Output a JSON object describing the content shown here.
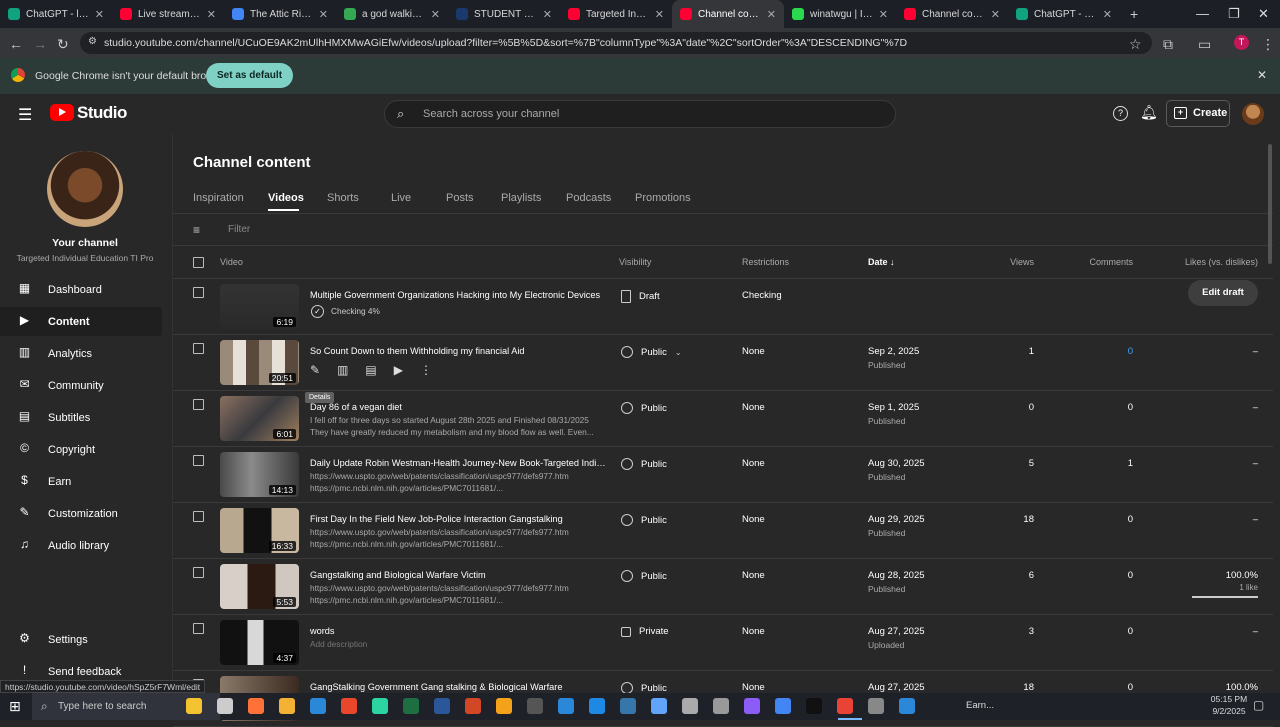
{
  "browser": {
    "tabs": [
      {
        "label": "ChatGPT - langua",
        "color": "#10a37f"
      },
      {
        "label": "Live streaming",
        "color": "#ff0033"
      },
      {
        "label": "The Attic Rite: Vo",
        "color": "#4285f4"
      },
      {
        "label": "a god walking the",
        "color": "#34a853"
      },
      {
        "label": "STUDENT SUPPOR",
        "color": "#1a3a6e"
      },
      {
        "label": "Targeted Individu",
        "color": "#ff0033"
      },
      {
        "label": "Channel content -",
        "color": "#ff0033"
      },
      {
        "label": "winatwgu | Instag",
        "color": "#2bd94f"
      },
      {
        "label": "Channel content -",
        "color": "#ff0033"
      },
      {
        "label": "ChatGPT - The Att",
        "color": "#10a37f"
      }
    ],
    "url": "studio.youtube.com/channel/UCuOE9AK2mUlhHMXMwAGiEfw/videos/upload?filter=%5B%5D&sort=%7B\"columnType\"%3A\"date\"%2C\"sortOrder\"%3A\"DESCENDING\"%7D",
    "infobar_text": "Google Chrome isn't your default browser",
    "set_default_label": "Set as default",
    "status_url": "https://studio.youtube.com/video/hSpZ5rF7Wml/edit"
  },
  "studio": {
    "logo_text": "Studio",
    "search_placeholder": "Search across your channel",
    "create_label": "Create",
    "avatar_letter": "T"
  },
  "sidebar": {
    "channel_label": "Your channel",
    "channel_name": "Targeted Individual Education TI Pro",
    "items": [
      {
        "label": "Dashboard",
        "icon": "dashboard-icon"
      },
      {
        "label": "Content",
        "icon": "content-icon"
      },
      {
        "label": "Analytics",
        "icon": "analytics-icon"
      },
      {
        "label": "Community",
        "icon": "community-icon"
      },
      {
        "label": "Subtitles",
        "icon": "subtitles-icon"
      },
      {
        "label": "Copyright",
        "icon": "copyright-icon"
      },
      {
        "label": "Earn",
        "icon": "earn-icon"
      },
      {
        "label": "Customization",
        "icon": "customization-icon"
      },
      {
        "label": "Audio library",
        "icon": "audio-library-icon"
      }
    ],
    "settings_label": "Settings",
    "feedback_label": "Send feedback"
  },
  "main": {
    "page_title": "Channel content",
    "tabs": [
      "Inspiration",
      "Videos",
      "Shorts",
      "Live",
      "Posts",
      "Playlists",
      "Podcasts",
      "Promotions"
    ],
    "active_tab": "Videos",
    "filter_placeholder": "Filter",
    "columns": {
      "video": "Video",
      "visibility": "Visibility",
      "restrictions": "Restrictions",
      "date": "Date",
      "views": "Views",
      "comments": "Comments",
      "likes": "Likes (vs. dislikes)"
    },
    "tooltip": "Details",
    "edit_draft_label": "Edit draft",
    "rows": [
      {
        "title": "Multiple Government Organizations Hacking into My Electronic Devices",
        "desc1": "Checking 4%",
        "desc2": "",
        "duration": "6:19",
        "visibility": "Draft",
        "restrictions": "Checking",
        "date": "",
        "status": "",
        "views": "",
        "comments": "",
        "likes": "",
        "likes_sub": ""
      },
      {
        "title": "So Count Down to them Withholding my financial Aid",
        "desc1": "",
        "desc2": "",
        "duration": "20:51",
        "visibility": "Public",
        "restrictions": "None",
        "date": "Sep 2, 2025",
        "status": "Published",
        "views": "1",
        "comments": "0",
        "likes": "–",
        "likes_sub": ""
      },
      {
        "title": "Day 86 of a vegan diet",
        "desc1": "I fell off for three days so started August 28th 2025 and Finished 08/31/2025",
        "desc2": "They have greatly reduced my metabolism and my blood flow as well. Even...",
        "duration": "6:01",
        "visibility": "Public",
        "restrictions": "None",
        "date": "Sep 1, 2025",
        "status": "Published",
        "views": "0",
        "comments": "0",
        "likes": "–",
        "likes_sub": ""
      },
      {
        "title": "Daily Update Robin Westman-Health Journey-New Book-Targeted Indivi...",
        "desc1": "https://www.uspto.gov/web/patents/classification/uspc977/defs977.htm",
        "desc2": "https://pmc.ncbi.nlm.nih.gov/articles/PMC7011681/...",
        "duration": "14:13",
        "visibility": "Public",
        "restrictions": "None",
        "date": "Aug 30, 2025",
        "status": "Published",
        "views": "5",
        "comments": "1",
        "likes": "–",
        "likes_sub": ""
      },
      {
        "title": "First Day In the Field New Job-Police Interaction Gangstalking",
        "desc1": "https://www.uspto.gov/web/patents/classification/uspc977/defs977.htm",
        "desc2": "https://pmc.ncbi.nlm.nih.gov/articles/PMC7011681/...",
        "duration": "16:33",
        "visibility": "Public",
        "restrictions": "None",
        "date": "Aug 29, 2025",
        "status": "Published",
        "views": "18",
        "comments": "0",
        "likes": "–",
        "likes_sub": ""
      },
      {
        "title": "Gangstalking and Biological Warfare Victim",
        "desc1": "https://www.uspto.gov/web/patents/classification/uspc977/defs977.htm",
        "desc2": "https://pmc.ncbi.nlm.nih.gov/articles/PMC7011681/...",
        "duration": "5:53",
        "visibility": "Public",
        "restrictions": "None",
        "date": "Aug 28, 2025",
        "status": "Published",
        "views": "6",
        "comments": "0",
        "likes": "100.0%",
        "likes_sub": "1 like"
      },
      {
        "title": "words",
        "desc1": "Add description",
        "desc2": "",
        "duration": "4:37",
        "visibility": "Private",
        "restrictions": "None",
        "date": "Aug 27, 2025",
        "status": "Uploaded",
        "views": "3",
        "comments": "0",
        "likes": "–",
        "likes_sub": ""
      },
      {
        "title": "GangStalking Government Gang stalking & Biological Warfare",
        "desc1": "",
        "desc2": "",
        "duration": "",
        "visibility": "Public",
        "restrictions": "None",
        "date": "Aug 27, 2025",
        "status": "",
        "views": "18",
        "comments": "0",
        "likes": "100.0%",
        "likes_sub": ""
      }
    ]
  },
  "taskbar": {
    "search_placeholder": "Type here to search",
    "earn_label": "Earn...",
    "time": "05:15 PM",
    "date": "9/2/2025"
  }
}
